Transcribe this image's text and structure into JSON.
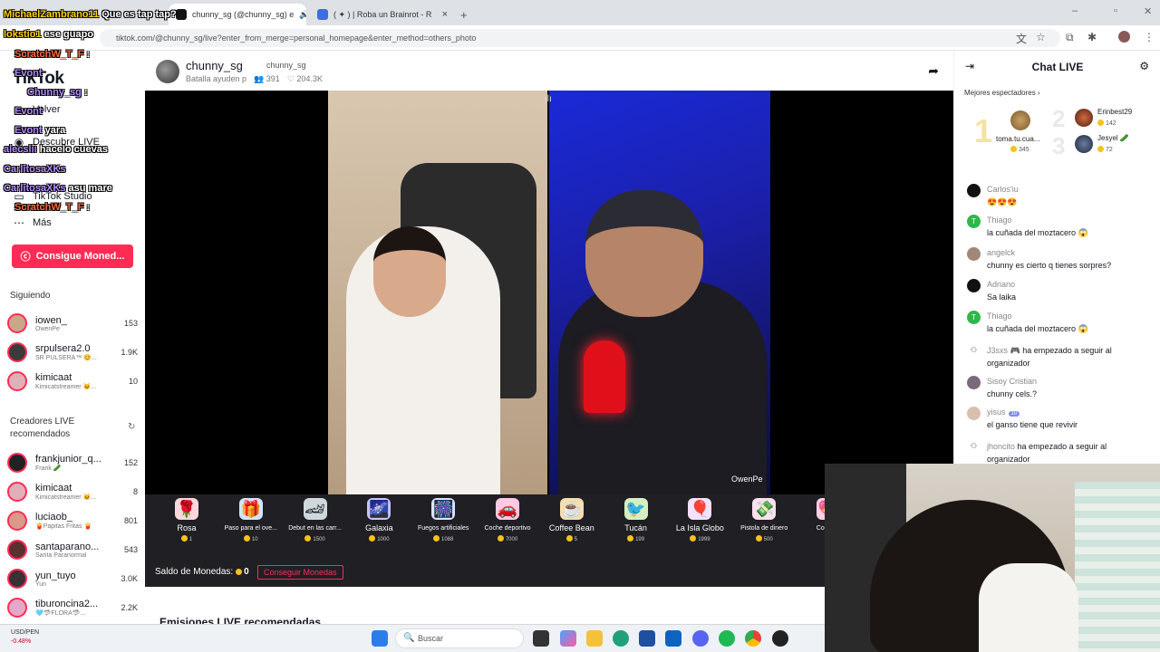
{
  "browser": {
    "tabs": [
      {
        "label": "chunny_sg (@chunny_sg) e",
        "active": true
      },
      {
        "label": "( ✦ ) | Roba un Brainrot - R",
        "active": false
      }
    ],
    "new_tab": "+",
    "close": "×",
    "url": "tiktok.com/@chunny_sg/live?enter_from_merge=personal_homepage&enter_method=others_photo"
  },
  "overlay_chat": [
    {
      "user": "MichaelZambrano11",
      "msg": "Que es tap tap?",
      "color": "y"
    },
    {
      "user": "lokstio1",
      "msg": "ese guapo",
      "color": "y"
    },
    {
      "user": "ScratchW_T_F",
      "msg": ":",
      "color": "p"
    },
    {
      "user": "Evont",
      "msg": "",
      "color": "p"
    },
    {
      "user": "Chunny_sg",
      "msg": ":",
      "color": "p"
    },
    {
      "user": "Evont",
      "msg": "",
      "color": "p"
    },
    {
      "user": "Evont",
      "msg": "yara",
      "color": "p"
    },
    {
      "user": "alecslii",
      "msg": "hacelo cuevas",
      "color": "p"
    },
    {
      "user": "CarlitosaXKs",
      "msg": "",
      "color": "p"
    },
    {
      "user": "CarlitosaXKs",
      "msg": "asu mare",
      "color": "p"
    },
    {
      "user": "ScratchW_T_F",
      "msg": ":",
      "color": "p"
    }
  ],
  "sidebar": {
    "logo": "TikTok",
    "nav": [
      {
        "label": "Volver"
      },
      {
        "label": "Descubre LIVE"
      },
      {
        "label": "TikTok Studio"
      },
      {
        "label": "Más"
      }
    ],
    "coins_button": "Consigue Moned...",
    "following_title": "Siguiendo",
    "following": [
      {
        "name": "iowen_",
        "sub": "OwenPe",
        "count": "153"
      },
      {
        "name": "srpulsera2.0",
        "sub": "SR PULSERA™ 😊...",
        "count": "1.9K"
      },
      {
        "name": "kimicaat",
        "sub": "Kimicatstreamer 🐱...",
        "count": "10"
      }
    ],
    "recommended_title": "Creadores LIVE recomendados",
    "recommended": [
      {
        "name": "frankjunior_q...",
        "sub": "Frank 🥒",
        "count": "152"
      },
      {
        "name": "kimicaat",
        "sub": "Kimicatstreamer 🐱...",
        "count": "8"
      },
      {
        "name": "luciaob_",
        "sub": "🍟Papitas Fritas 🍟",
        "count": "801"
      },
      {
        "name": "santaparano...",
        "sub": "Santa Paranormal",
        "count": "543"
      },
      {
        "name": "yun_tuyo",
        "sub": "Yun",
        "count": "3.0K"
      },
      {
        "name": "tiburoncina2...",
        "sub": "🩵🦈FLORA🦈...",
        "count": "2.2K"
      }
    ]
  },
  "live": {
    "host_name": "chunny_sg",
    "host_handle": "chunny_sg",
    "subtitle": "Batalla ayuden p",
    "viewers": "391",
    "likes": "204.3K",
    "cam_label": "OwenPe"
  },
  "gifts": [
    {
      "name": "Rosa",
      "price": "1",
      "icon": "🌹",
      "big": true
    },
    {
      "name": "Paso para el ove...",
      "price": "10",
      "icon": "🎁",
      "big": false
    },
    {
      "name": "Debut en las carr...",
      "price": "1500",
      "icon": "🏎",
      "big": false
    },
    {
      "name": "Galaxia",
      "price": "1000",
      "icon": "🌌",
      "big": true
    },
    {
      "name": "Fuegos artificiales",
      "price": "1088",
      "icon": "🎆",
      "big": false
    },
    {
      "name": "Coche deportivo",
      "price": "7000",
      "icon": "🚗",
      "big": false
    },
    {
      "name": "Coffee Bean",
      "price": "5",
      "icon": "☕",
      "big": true
    },
    {
      "name": "Tucán",
      "price": "199",
      "icon": "🐦",
      "big": true
    },
    {
      "name": "La Isla Globo",
      "price": "1999",
      "icon": "🎈",
      "big": true
    },
    {
      "name": "Pistola de dinero",
      "price": "500",
      "icon": "💸",
      "big": false
    },
    {
      "name": "Corazón",
      "price": "",
      "icon": "💖",
      "big": false
    }
  ],
  "balance": {
    "label": "Saldo de Monedas:",
    "value": "0",
    "button": "Conseguir Monedas"
  },
  "recommended_streams_title": "Emisiones LIVE recomendadas",
  "chat": {
    "title": "Chat LIVE",
    "top_label": "Mejores espectadores",
    "top_viewers": [
      {
        "rank": "1",
        "name": "toma.tu.cua...",
        "score": "345"
      },
      {
        "rank": "2",
        "name": "Erinbest29",
        "score": "142"
      },
      {
        "rank": "3",
        "name": "Jesyel 🥒",
        "score": "72"
      }
    ],
    "messages": [
      {
        "user": "",
        "text": "😍😍😍",
        "avatar": "#e9e9e9",
        "initial": ""
      },
      {
        "user": "Carlos'iu",
        "text": "😍😍😍",
        "avatar": "#111111",
        "initial": ""
      },
      {
        "user": "Thiago",
        "text": "la cuñada del moztacero 😱",
        "avatar": "#2fb74a",
        "initial": "T"
      },
      {
        "user": "angelck",
        "text": "chunny es cierto q tienes sorpres?",
        "avatar": "#a08878",
        "initial": ""
      },
      {
        "user": "Adriano",
        "text": "Sa laika",
        "avatar": "#111111",
        "initial": ""
      },
      {
        "user": "Thiago",
        "text": "la cuñada del moztacero 😱",
        "avatar": "#2fb74a",
        "initial": "T"
      },
      {
        "user": "J3sxs 🎮",
        "text": "ha empezado a seguir al organizador",
        "avatar": "",
        "initial": "",
        "follow": true
      },
      {
        "user": "Sisoy Cristian",
        "text": "chunny cels.?",
        "avatar": "#7a6a7a",
        "initial": ""
      },
      {
        "user": "yisus",
        "text": "el ganso tiene que revivir",
        "avatar": "#d8c0b0",
        "initial": "",
        "level": "10"
      },
      {
        "user": "jhoncito",
        "text": "ha empezado a seguir al organizador",
        "avatar": "",
        "initial": "",
        "follow": true
      }
    ]
  },
  "taskbar": {
    "ticker_pair": "USD/PEN",
    "ticker_change": "-0.48%",
    "search_placeholder": "Buscar"
  },
  "colors": {
    "accent": "#fe2c55",
    "gift_bar": "#1f1f24",
    "coin": "#f7c21a"
  }
}
